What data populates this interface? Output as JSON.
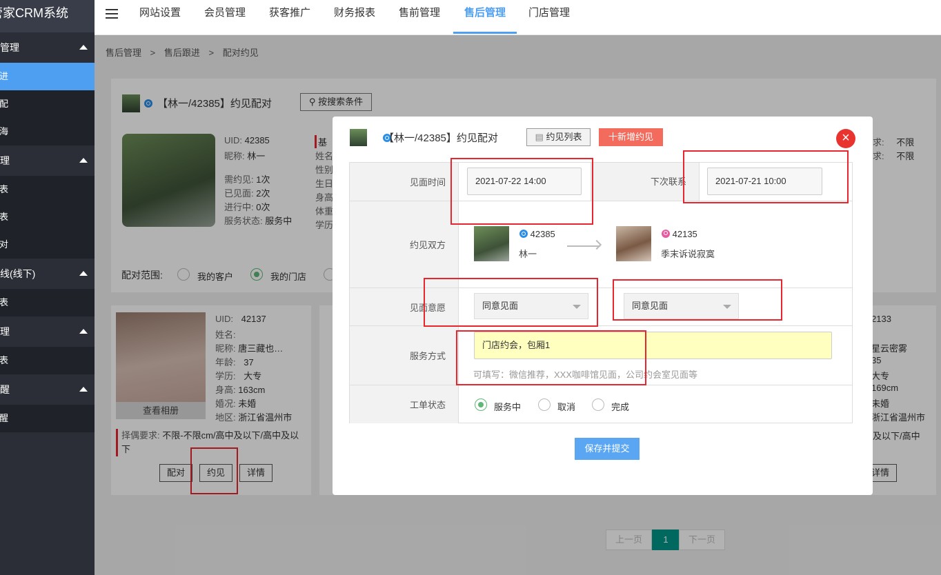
{
  "sidebar": {
    "logo": "管家CRM系统",
    "groups": [
      {
        "label": "售后管理",
        "items": [
          "售后跟进",
          "售后分配",
          "售后公海"
        ]
      },
      {
        "label": "约见管理",
        "items": [
          "约见列表",
          "见面列表",
          "见面配对"
        ]
      },
      {
        "label": "牵线(线下)",
        "items": [
          "牵线列表"
        ]
      },
      {
        "label": "工单管理",
        "items": [
          "工单列表"
        ]
      },
      {
        "label": "提醒",
        "items": [
          "提醒"
        ]
      }
    ],
    "labels": {
      "g0": "售管理",
      "g0i0": "跟进",
      "g0i1": "分配",
      "g0i2": "公海",
      "g1": "管理",
      "g1i0": "列表",
      "g1i1": "列表",
      "g1i2": "配对",
      "g2": "牵线(线下)",
      "g2i0": "列表",
      "g3": "管理",
      "g3i0": "列表",
      "g4": "提醒",
      "g4i0": "提醒"
    }
  },
  "topnav": {
    "items": [
      "网站设置",
      "会员管理",
      "获客推广",
      "财务报表",
      "售前管理",
      "售后管理",
      "门店管理"
    ],
    "active": "售后管理"
  },
  "breadcrumb": {
    "a": "售后管理",
    "b": "售后跟进",
    "c": "配对约见",
    "sep": ">"
  },
  "background": {
    "title": "【林一/42385】约见配对",
    "search_btn": "按搜索条件",
    "uid_label": "UID:",
    "uid": "42385",
    "nick_label": "昵称:",
    "nick": "林一",
    "need_label": "需约见:",
    "need": "1次",
    "met_label": "已见面:",
    "met": "2次",
    "doing_label": "进行中:",
    "doing": "0次",
    "status_label": "服务状态:",
    "status": "服务中",
    "col2": [
      "基",
      "姓名",
      "性别",
      "生日",
      "身高",
      "体重",
      "学历"
    ],
    "right1": "求:",
    "right1v": "不限",
    "right2": "求:",
    "right2v": "不限",
    "range_label": "配对范围:",
    "range_opt1": "我的客户",
    "range_opt2": "我的门店",
    "card1": {
      "uid_label": "UID:",
      "uid": "42137",
      "name_label": "姓名:",
      "name": "",
      "nick_label": "昵称:",
      "nick": "唐三藏也…",
      "age_label": "年龄:",
      "age": "37",
      "edu_label": "学历:",
      "edu": "大专",
      "height_label": "身高:",
      "height": "163cm",
      "marry_label": "婚况:",
      "marry": "未婚",
      "area_label": "地区:",
      "area": "浙江省温州市",
      "album": "查看相册",
      "req_label": "择偶要求:",
      "req": "不限-不限cm/高中及以下/高中及以下",
      "btn_pair": "配对",
      "btn_meet": "约见",
      "btn_detail": "详情"
    },
    "card3": {
      "uid": "2133",
      "nick": "星云密雾",
      "age": "35",
      "edu": "大专",
      "height": "169cm",
      "marry": "未婚",
      "area": "浙江省温州市",
      "req": "及以下/高中",
      "btn_detail": "详情"
    },
    "pager": {
      "prev": "上一页",
      "current": "1",
      "next": "下一页"
    }
  },
  "modal": {
    "title": "【林一/42385】约见配对",
    "list_btn": "约见列表",
    "add_btn": "十新增约见",
    "close": "×",
    "meet_time_label": "见面时间",
    "meet_time": "2021-07-22 14:00",
    "next_contact_label": "下次联系",
    "next_contact": "2021-07-21 10:00",
    "parties_label": "约见双方",
    "party_a": {
      "uid": "42385",
      "name": "林一"
    },
    "party_b": {
      "uid": "42135",
      "name": "季末诉说寂寞"
    },
    "willing_label": "见面意愿",
    "willing_a": "同意见面",
    "willing_b": "同意见面",
    "service_label": "服务方式",
    "service_value": "门店约会，包厢1",
    "service_hint": "可填写：微信推荐，XXX咖啡馆见面，公司约会室见面等",
    "status_label": "工单状态",
    "status_options": [
      "服务中",
      "取消",
      "完成"
    ],
    "status_selected": "服务中",
    "submit": "保存并提交"
  },
  "colors": {
    "accent": "#4e9ff2",
    "danger": "#e8332f",
    "add": "#f26b5c",
    "pager": "#009688",
    "highlight": "#ffffc0"
  }
}
